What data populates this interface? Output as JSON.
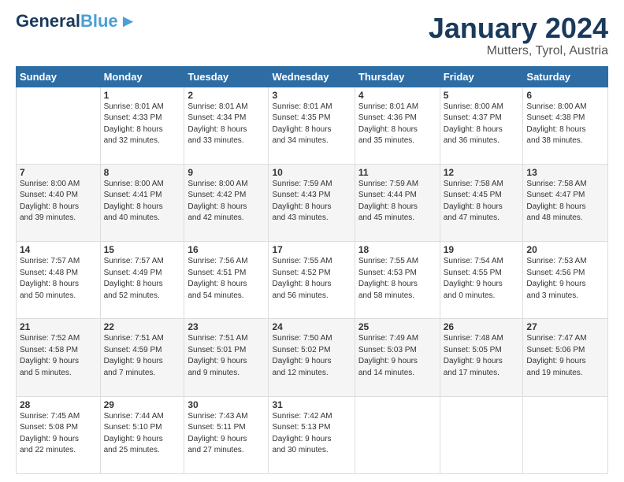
{
  "logo": {
    "line1": "General",
    "line2": "Blue"
  },
  "header": {
    "month": "January 2024",
    "location": "Mutters, Tyrol, Austria"
  },
  "weekdays": [
    "Sunday",
    "Monday",
    "Tuesday",
    "Wednesday",
    "Thursday",
    "Friday",
    "Saturday"
  ],
  "weeks": [
    [
      {
        "day": "",
        "info": ""
      },
      {
        "day": "1",
        "info": "Sunrise: 8:01 AM\nSunset: 4:33 PM\nDaylight: 8 hours\nand 32 minutes."
      },
      {
        "day": "2",
        "info": "Sunrise: 8:01 AM\nSunset: 4:34 PM\nDaylight: 8 hours\nand 33 minutes."
      },
      {
        "day": "3",
        "info": "Sunrise: 8:01 AM\nSunset: 4:35 PM\nDaylight: 8 hours\nand 34 minutes."
      },
      {
        "day": "4",
        "info": "Sunrise: 8:01 AM\nSunset: 4:36 PM\nDaylight: 8 hours\nand 35 minutes."
      },
      {
        "day": "5",
        "info": "Sunrise: 8:00 AM\nSunset: 4:37 PM\nDaylight: 8 hours\nand 36 minutes."
      },
      {
        "day": "6",
        "info": "Sunrise: 8:00 AM\nSunset: 4:38 PM\nDaylight: 8 hours\nand 38 minutes."
      }
    ],
    [
      {
        "day": "7",
        "info": "Sunrise: 8:00 AM\nSunset: 4:40 PM\nDaylight: 8 hours\nand 39 minutes."
      },
      {
        "day": "8",
        "info": "Sunrise: 8:00 AM\nSunset: 4:41 PM\nDaylight: 8 hours\nand 40 minutes."
      },
      {
        "day": "9",
        "info": "Sunrise: 8:00 AM\nSunset: 4:42 PM\nDaylight: 8 hours\nand 42 minutes."
      },
      {
        "day": "10",
        "info": "Sunrise: 7:59 AM\nSunset: 4:43 PM\nDaylight: 8 hours\nand 43 minutes."
      },
      {
        "day": "11",
        "info": "Sunrise: 7:59 AM\nSunset: 4:44 PM\nDaylight: 8 hours\nand 45 minutes."
      },
      {
        "day": "12",
        "info": "Sunrise: 7:58 AM\nSunset: 4:45 PM\nDaylight: 8 hours\nand 47 minutes."
      },
      {
        "day": "13",
        "info": "Sunrise: 7:58 AM\nSunset: 4:47 PM\nDaylight: 8 hours\nand 48 minutes."
      }
    ],
    [
      {
        "day": "14",
        "info": "Sunrise: 7:57 AM\nSunset: 4:48 PM\nDaylight: 8 hours\nand 50 minutes."
      },
      {
        "day": "15",
        "info": "Sunrise: 7:57 AM\nSunset: 4:49 PM\nDaylight: 8 hours\nand 52 minutes."
      },
      {
        "day": "16",
        "info": "Sunrise: 7:56 AM\nSunset: 4:51 PM\nDaylight: 8 hours\nand 54 minutes."
      },
      {
        "day": "17",
        "info": "Sunrise: 7:55 AM\nSunset: 4:52 PM\nDaylight: 8 hours\nand 56 minutes."
      },
      {
        "day": "18",
        "info": "Sunrise: 7:55 AM\nSunset: 4:53 PM\nDaylight: 8 hours\nand 58 minutes."
      },
      {
        "day": "19",
        "info": "Sunrise: 7:54 AM\nSunset: 4:55 PM\nDaylight: 9 hours\nand 0 minutes."
      },
      {
        "day": "20",
        "info": "Sunrise: 7:53 AM\nSunset: 4:56 PM\nDaylight: 9 hours\nand 3 minutes."
      }
    ],
    [
      {
        "day": "21",
        "info": "Sunrise: 7:52 AM\nSunset: 4:58 PM\nDaylight: 9 hours\nand 5 minutes."
      },
      {
        "day": "22",
        "info": "Sunrise: 7:51 AM\nSunset: 4:59 PM\nDaylight: 9 hours\nand 7 minutes."
      },
      {
        "day": "23",
        "info": "Sunrise: 7:51 AM\nSunset: 5:01 PM\nDaylight: 9 hours\nand 9 minutes."
      },
      {
        "day": "24",
        "info": "Sunrise: 7:50 AM\nSunset: 5:02 PM\nDaylight: 9 hours\nand 12 minutes."
      },
      {
        "day": "25",
        "info": "Sunrise: 7:49 AM\nSunset: 5:03 PM\nDaylight: 9 hours\nand 14 minutes."
      },
      {
        "day": "26",
        "info": "Sunrise: 7:48 AM\nSunset: 5:05 PM\nDaylight: 9 hours\nand 17 minutes."
      },
      {
        "day": "27",
        "info": "Sunrise: 7:47 AM\nSunset: 5:06 PM\nDaylight: 9 hours\nand 19 minutes."
      }
    ],
    [
      {
        "day": "28",
        "info": "Sunrise: 7:45 AM\nSunset: 5:08 PM\nDaylight: 9 hours\nand 22 minutes."
      },
      {
        "day": "29",
        "info": "Sunrise: 7:44 AM\nSunset: 5:10 PM\nDaylight: 9 hours\nand 25 minutes."
      },
      {
        "day": "30",
        "info": "Sunrise: 7:43 AM\nSunset: 5:11 PM\nDaylight: 9 hours\nand 27 minutes."
      },
      {
        "day": "31",
        "info": "Sunrise: 7:42 AM\nSunset: 5:13 PM\nDaylight: 9 hours\nand 30 minutes."
      },
      {
        "day": "",
        "info": ""
      },
      {
        "day": "",
        "info": ""
      },
      {
        "day": "",
        "info": ""
      }
    ]
  ]
}
